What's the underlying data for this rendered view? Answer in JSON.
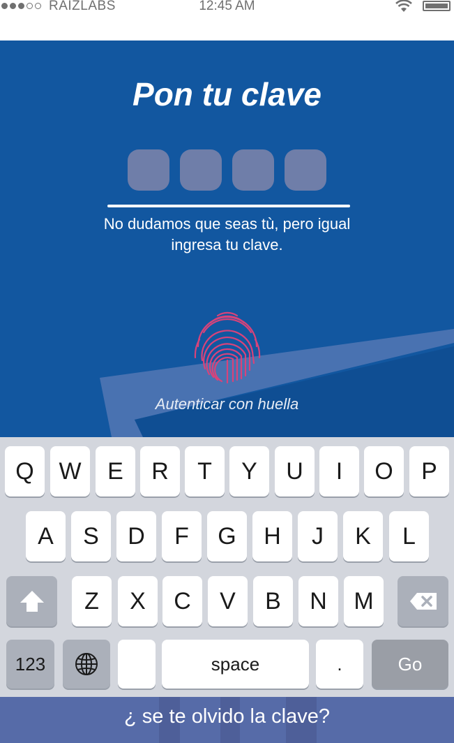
{
  "status_bar": {
    "carrier": "RAIZLABS",
    "time": "12:45 AM",
    "signal_bars_filled": 3,
    "signal_bars_total": 5,
    "wifi_icon": "wifi-icon",
    "battery_icon": "battery-icon",
    "battery_level": 1.0
  },
  "login": {
    "title": "Pon tu clave",
    "pin_length": 4,
    "message_line1": "No dudamos que seas tù, pero igual",
    "message_line2": "ingresa tu clave.",
    "fingerprint_icon": "fingerprint-icon",
    "fingerprint_label": "Autenticar con huella"
  },
  "keyboard": {
    "row1": [
      "Q",
      "W",
      "E",
      "R",
      "T",
      "Y",
      "U",
      "I",
      "O",
      "P"
    ],
    "row2": [
      "A",
      "S",
      "D",
      "F",
      "G",
      "H",
      "J",
      "K",
      "L"
    ],
    "row3": [
      "Z",
      "X",
      "C",
      "V",
      "B",
      "N",
      "M"
    ],
    "shift_icon": "shift-arrow-icon",
    "backspace_icon": "backspace-icon",
    "numbers_label": "123",
    "globe_icon": "globe-icon",
    "space_label": "space",
    "period_label": ".",
    "go_label": "Go"
  },
  "footer": {
    "forgot_label": "¿ se te olvido la clave?"
  },
  "colors": {
    "panel": "#1257a0",
    "pin_box": "#6f7ea9",
    "keyboard_bg": "#d3d6dd",
    "footer_bg": "#566ba8",
    "fingerprint": "#d8437a"
  }
}
